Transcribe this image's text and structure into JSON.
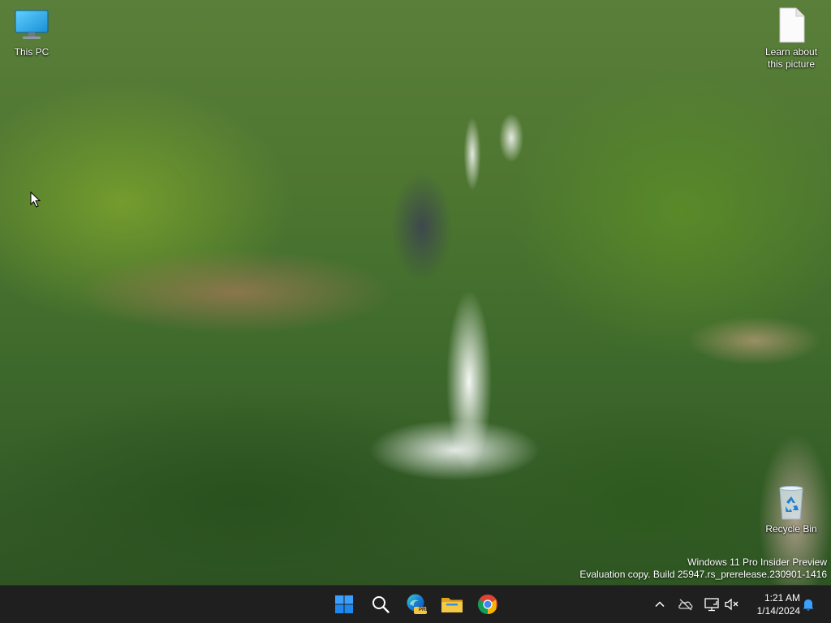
{
  "desktop": {
    "icons": [
      {
        "label": "This PC",
        "icon": "monitor-icon"
      },
      {
        "label": "Learn about\nthis picture",
        "icon": "document-icon"
      },
      {
        "label": "Recycle Bin",
        "icon": "recycle-bin-icon"
      }
    ],
    "watermark": {
      "line1": "Windows 11 Pro Insider Preview",
      "line2": "Evaluation copy. Build 25947.rs_prerelease.230901-1416"
    }
  },
  "taskbar": {
    "apps": [
      {
        "name": "Start",
        "icon": "windows-start-icon"
      },
      {
        "name": "Search",
        "icon": "search-icon"
      },
      {
        "name": "Microsoft Edge Preview",
        "icon": "edge-pre-icon",
        "badge": "PRE"
      },
      {
        "name": "File Explorer",
        "icon": "folder-icon"
      },
      {
        "name": "Google Chrome",
        "icon": "chrome-icon"
      }
    ],
    "tray": {
      "icons": [
        "chevron-up-icon",
        "onedrive-off-icon",
        "network-icon",
        "volume-muted-icon",
        "notification-bell-icon"
      ],
      "time": "1:21 AM",
      "date": "1/14/2024"
    }
  },
  "colors": {
    "taskbar_bg": "#1f1f1f",
    "start_blue": "#1e90ff",
    "folder_yellow": "#f4c542"
  }
}
